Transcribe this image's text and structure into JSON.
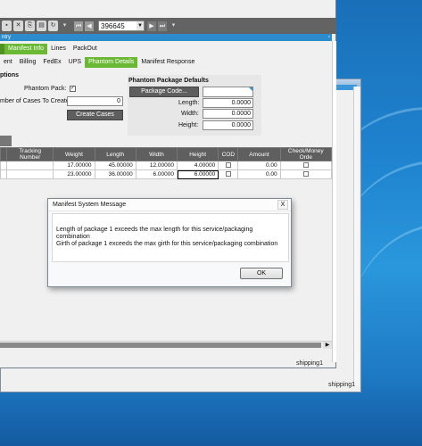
{
  "toolbar": {
    "order_number": "396645"
  },
  "window": {
    "title_fragment": "ntry"
  },
  "tabs_primary": [
    {
      "label": "Manifest Info",
      "active": true
    },
    {
      "label": "Lines",
      "active": false
    },
    {
      "label": "PackOut",
      "active": false
    }
  ],
  "tabs_secondary": [
    {
      "label": "ent",
      "active": false
    },
    {
      "label": "Billing",
      "active": false
    },
    {
      "label": "FedEx",
      "active": false
    },
    {
      "label": "UPS",
      "active": false
    },
    {
      "label": "Phantom Details",
      "active": true
    },
    {
      "label": "Manifest Response",
      "active": false
    }
  ],
  "options": {
    "title": "ptions",
    "phantom_pack_label": "Phantom Pack:",
    "phantom_pack_checked": true,
    "cases_label": "mber of Cases To Create:",
    "cases_value": "0",
    "create_cases_button": "Create Cases"
  },
  "phantom_defaults": {
    "title": "Phantom Package Defaults",
    "package_code_button": "Package Code...",
    "length_label": "Length:",
    "length_value": "0.0000",
    "width_label": "Width:",
    "width_value": "0.0000",
    "height_label": "Height:",
    "height_value": "0.0000"
  },
  "grid": {
    "columns": [
      "Tracking Number",
      "Weight",
      "Length",
      "Width",
      "Height",
      "COD",
      "Amount",
      "Check/Money Orde"
    ],
    "rows": [
      {
        "tracking": "",
        "weight": "17.00000",
        "length": "45.00000",
        "width": "12.00000",
        "height": "4.00000",
        "cod": false,
        "amount": "0.00",
        "check": false
      },
      {
        "tracking": "",
        "weight": "23.00000",
        "length": "36.00000",
        "width": "6.00000",
        "height": "6.00000",
        "cod": false,
        "amount": "0.00",
        "check": false
      }
    ]
  },
  "status": {
    "win1_user": "shipping1",
    "win2_user": "shipping1"
  },
  "dialog": {
    "title": "Manifest System Message",
    "close_glyph": "X",
    "line1": "Length of package 1 exceeds the max length for this service/packaging",
    "line2": "combination",
    "line3": "Girth of package 1 exceeds the max girth for this service/packaging combination",
    "ok_label": "OK"
  }
}
